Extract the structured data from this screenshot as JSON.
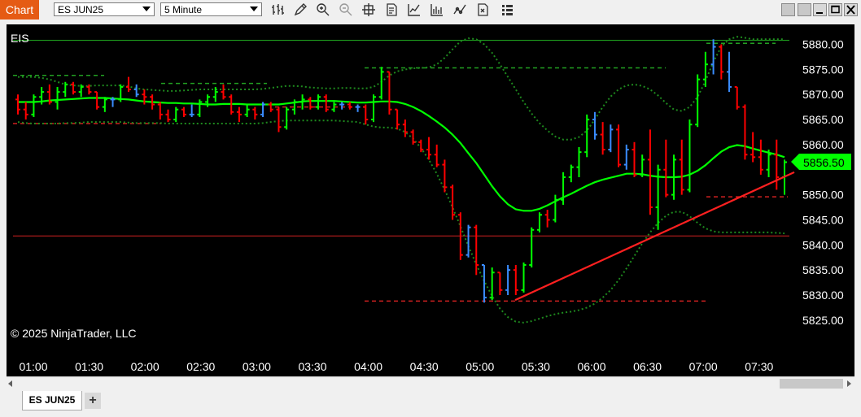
{
  "window": {
    "app_title": "Chart",
    "instrument": "ES JUN25",
    "interval": "5 Minute",
    "tab_label": "ES JUN25",
    "add_tab": "+"
  },
  "toolbar_icons": [
    "bar-type-icon",
    "draw-tool-icon",
    "zoom-in-icon",
    "zoom-out-icon",
    "crosshair-icon",
    "data-box-icon",
    "indicators-icon",
    "strategies-icon",
    "properties-icon",
    "templates-icon"
  ],
  "chart": {
    "label": "EIS",
    "copyright": "© 2025 NinjaTrader, LLC",
    "current_price": "5856.50",
    "colors": {
      "up": "#00ff00",
      "down": "#ff0000",
      "neutral": "#3a8cff",
      "ma": "#00ff00",
      "band": "#1e8a1e",
      "trendline": "#ff2020",
      "price_tag": "#00ff00"
    }
  },
  "chart_data": {
    "type": "bar",
    "instrument": "ES JUN25",
    "interval": "5 Minute",
    "ylim": [
      5821,
      5883
    ],
    "y_ticks": [
      "5880.00",
      "5875.00",
      "5870.00",
      "5865.00",
      "5860.00",
      "5855.00",
      "5850.00",
      "5845.00",
      "5840.00",
      "5835.00",
      "5830.00",
      "5825.00"
    ],
    "x_ticks": [
      "01:00",
      "01:30",
      "02:00",
      "02:30",
      "03:00",
      "03:30",
      "04:00",
      "04:30",
      "05:00",
      "05:30",
      "06:00",
      "06:30",
      "07:00",
      "07:30"
    ],
    "last_price": 5856.5,
    "ohlc": [
      [
        5869.0,
        5870.0,
        5866.0,
        5867.0
      ],
      [
        5867.0,
        5868.5,
        5865.0,
        5866.0
      ],
      [
        5866.0,
        5870.0,
        5865.5,
        5869.5
      ],
      [
        5869.5,
        5871.5,
        5868.0,
        5870.5
      ],
      [
        5870.5,
        5872.0,
        5868.0,
        5868.5
      ],
      [
        5868.5,
        5871.5,
        5867.0,
        5870.5
      ],
      [
        5870.5,
        5872.5,
        5869.5,
        5872.0
      ],
      [
        5872.0,
        5872.5,
        5870.0,
        5870.5
      ],
      [
        5870.5,
        5872.0,
        5869.5,
        5871.5
      ],
      [
        5871.5,
        5872.0,
        5870.0,
        5870.5
      ],
      [
        5870.5,
        5870.5,
        5867.0,
        5867.5
      ],
      [
        5867.5,
        5869.5,
        5866.5,
        5869.0
      ],
      [
        5869.0,
        5869.5,
        5867.5,
        5869.0
      ],
      [
        5869.0,
        5872.0,
        5868.5,
        5871.5
      ],
      [
        5871.5,
        5873.5,
        5870.5,
        5871.0
      ],
      [
        5871.0,
        5872.0,
        5869.5,
        5870.0
      ],
      [
        5870.0,
        5871.0,
        5868.0,
        5869.5
      ],
      [
        5869.5,
        5870.0,
        5867.0,
        5868.0
      ],
      [
        5868.0,
        5868.5,
        5865.0,
        5866.0
      ],
      [
        5866.0,
        5867.0,
        5864.5,
        5865.0
      ],
      [
        5865.0,
        5867.5,
        5864.5,
        5867.0
      ],
      [
        5867.0,
        5867.5,
        5865.5,
        5866.0
      ],
      [
        5866.0,
        5868.0,
        5865.5,
        5866.0
      ],
      [
        5866.0,
        5869.0,
        5865.5,
        5868.5
      ],
      [
        5868.5,
        5870.0,
        5867.5,
        5869.5
      ],
      [
        5869.5,
        5871.5,
        5868.5,
        5870.5
      ],
      [
        5870.5,
        5872.0,
        5869.0,
        5869.5
      ],
      [
        5869.5,
        5870.0,
        5866.0,
        5866.5
      ],
      [
        5866.5,
        5867.5,
        5864.5,
        5866.0
      ],
      [
        5866.0,
        5868.0,
        5865.5,
        5867.0
      ],
      [
        5867.0,
        5867.5,
        5865.0,
        5866.0
      ],
      [
        5866.0,
        5868.5,
        5865.5,
        5868.0
      ],
      [
        5868.0,
        5868.5,
        5866.5,
        5867.0
      ],
      [
        5867.0,
        5867.5,
        5862.5,
        5863.5
      ],
      [
        5863.5,
        5867.5,
        5863.0,
        5867.0
      ],
      [
        5867.0,
        5869.0,
        5866.0,
        5868.5
      ],
      [
        5868.5,
        5870.0,
        5867.0,
        5869.0
      ],
      [
        5869.0,
        5869.5,
        5867.0,
        5867.5
      ],
      [
        5867.5,
        5870.0,
        5867.0,
        5869.5
      ],
      [
        5869.5,
        5870.0,
        5866.5,
        5867.0
      ],
      [
        5867.0,
        5868.5,
        5866.5,
        5868.0
      ],
      [
        5868.0,
        5868.5,
        5867.0,
        5868.0
      ],
      [
        5868.0,
        5868.5,
        5867.0,
        5867.5
      ],
      [
        5867.5,
        5868.0,
        5866.5,
        5867.5
      ],
      [
        5867.5,
        5868.0,
        5864.0,
        5865.0
      ],
      [
        5865.0,
        5870.0,
        5864.5,
        5869.5
      ],
      [
        5869.5,
        5875.5,
        5869.0,
        5874.5
      ],
      [
        5874.5,
        5874.5,
        5866.0,
        5867.0
      ],
      [
        5867.0,
        5867.0,
        5863.0,
        5864.0
      ],
      [
        5864.0,
        5865.0,
        5861.5,
        5862.5
      ],
      [
        5862.5,
        5863.0,
        5860.0,
        5860.5
      ],
      [
        5860.5,
        5861.0,
        5858.5,
        5859.0
      ],
      [
        5859.0,
        5861.5,
        5857.0,
        5858.0
      ],
      [
        5858.0,
        5860.0,
        5855.5,
        5856.0
      ],
      [
        5856.0,
        5857.0,
        5850.5,
        5851.5
      ],
      [
        5851.5,
        5852.0,
        5845.0,
        5846.0
      ],
      [
        5846.0,
        5846.5,
        5837.0,
        5838.0
      ],
      [
        5838.0,
        5844.0,
        5837.5,
        5843.5
      ],
      [
        5843.5,
        5844.0,
        5834.0,
        5836.0
      ],
      [
        5836.0,
        5836.0,
        5828.5,
        5829.5
      ],
      [
        5829.5,
        5835.5,
        5829.0,
        5834.5
      ],
      [
        5834.5,
        5834.5,
        5830.0,
        5831.0
      ],
      [
        5831.0,
        5836.0,
        5830.0,
        5835.0
      ],
      [
        5835.0,
        5836.0,
        5830.0,
        5831.0
      ],
      [
        5831.0,
        5836.5,
        5830.5,
        5836.0
      ],
      [
        5836.0,
        5843.5,
        5835.5,
        5843.0
      ],
      [
        5843.0,
        5846.5,
        5842.5,
        5846.0
      ],
      [
        5846.0,
        5847.0,
        5843.5,
        5845.0
      ],
      [
        5845.0,
        5850.0,
        5844.5,
        5849.0
      ],
      [
        5849.0,
        5854.5,
        5848.0,
        5853.5
      ],
      [
        5853.5,
        5856.0,
        5852.5,
        5855.5
      ],
      [
        5855.5,
        5859.5,
        5853.5,
        5858.5
      ],
      [
        5858.5,
        5866.0,
        5857.5,
        5865.0
      ],
      [
        5865.0,
        5866.5,
        5861.0,
        5862.0
      ],
      [
        5862.0,
        5864.5,
        5858.0,
        5859.0
      ],
      [
        5859.0,
        5864.0,
        5858.5,
        5863.0
      ],
      [
        5863.0,
        5864.0,
        5855.5,
        5856.0
      ],
      [
        5856.0,
        5860.0,
        5855.0,
        5859.0
      ],
      [
        5859.0,
        5860.5,
        5853.5,
        5854.0
      ],
      [
        5854.0,
        5858.0,
        5853.5,
        5857.0
      ],
      [
        5857.0,
        5863.0,
        5846.0,
        5847.5
      ],
      [
        5847.5,
        5856.0,
        5843.0,
        5855.0
      ],
      [
        5855.0,
        5861.0,
        5849.5,
        5850.0
      ],
      [
        5850.0,
        5858.0,
        5849.0,
        5857.0
      ],
      [
        5857.0,
        5861.0,
        5850.0,
        5851.0
      ],
      [
        5851.0,
        5865.0,
        5850.5,
        5864.0
      ],
      [
        5864.0,
        5874.0,
        5863.5,
        5873.0
      ],
      [
        5873.0,
        5878.5,
        5871.5,
        5876.0
      ],
      [
        5876.0,
        5881.0,
        5874.0,
        5879.5
      ],
      [
        5879.5,
        5880.0,
        5873.0,
        5874.5
      ],
      [
        5874.5,
        5878.5,
        5870.5,
        5871.5
      ],
      [
        5871.5,
        5871.5,
        5867.0,
        5867.5
      ],
      [
        5867.5,
        5868.0,
        5857.0,
        5858.0
      ],
      [
        5858.0,
        5862.5,
        5856.5,
        5857.5
      ],
      [
        5857.5,
        5861.0,
        5854.0,
        5855.0
      ],
      [
        5855.0,
        5859.0,
        5853.5,
        5858.0
      ],
      [
        5858.0,
        5861.0,
        5851.0,
        5853.5
      ],
      [
        5853.5,
        5857.0,
        5850.0,
        5856.5
      ]
    ],
    "moving_average": [
      5868.5,
      5868.5,
      5868.5,
      5868.6,
      5868.8,
      5868.9,
      5869.0,
      5869.1,
      5869.2,
      5869.3,
      5869.3,
      5869.3,
      5869.2,
      5869.1,
      5869.0,
      5868.8,
      5868.6,
      5868.5,
      5868.4,
      5868.3,
      5868.3,
      5868.2,
      5868.2,
      5868.1,
      5868.0,
      5868.0,
      5868.1,
      5868.1,
      5868.1,
      5868.0,
      5868.0,
      5868.0,
      5868.0,
      5868.0,
      5868.2,
      5868.4,
      5868.6,
      5868.7,
      5868.7,
      5868.7,
      5868.7,
      5868.6,
      5868.5,
      5868.4,
      5868.4,
      5868.5,
      5868.6,
      5868.6,
      5868.5,
      5868.1,
      5867.5,
      5866.7,
      5865.7,
      5864.6,
      5863.4,
      5862.0,
      5860.3,
      5858.3,
      5856.3,
      5854.0,
      5851.7,
      5849.7,
      5848.1,
      5847.1,
      5846.8,
      5846.8,
      5847.2,
      5847.9,
      5848.7,
      5849.5,
      5850.2,
      5851.0,
      5851.8,
      5852.5,
      5853.0,
      5853.4,
      5853.8,
      5854.2,
      5854.2,
      5854.1,
      5853.8,
      5853.6,
      5853.5,
      5853.5,
      5853.6,
      5854.0,
      5854.8,
      5855.9,
      5857.3,
      5858.6,
      5859.5,
      5859.9,
      5859.7,
      5859.2,
      5858.8,
      5858.4,
      5858.0,
      5857.5
    ],
    "band_upper": [
      5873.5,
      5873.5,
      5873.5,
      5873.3,
      5873.0,
      5872.5,
      5872.0,
      5871.8,
      5871.7,
      5871.7,
      5871.8,
      5871.8,
      5871.8,
      5871.8,
      5871.6,
      5871.2,
      5871.0,
      5870.9,
      5870.8,
      5870.7,
      5870.7,
      5870.8,
      5870.9,
      5871.0,
      5871.0,
      5871.0,
      5871.0,
      5871.0,
      5871.0,
      5871.0,
      5871.0,
      5871.1,
      5871.3,
      5871.5,
      5871.7,
      5871.7,
      5871.6,
      5871.4,
      5871.3,
      5871.2,
      5871.2,
      5871.3,
      5871.3,
      5871.2,
      5871.2,
      5871.5,
      5872.5,
      5873.8,
      5874.6,
      5875.0,
      5875.2,
      5875.3,
      5875.4,
      5876.0,
      5877.3,
      5879.0,
      5880.6,
      5881.2,
      5881.0,
      5880.0,
      5878.3,
      5876.0,
      5873.5,
      5871.0,
      5868.5,
      5866.2,
      5864.3,
      5862.8,
      5861.6,
      5861.0,
      5861.0,
      5861.5,
      5862.8,
      5865.0,
      5867.5,
      5869.6,
      5871.0,
      5871.8,
      5872.0,
      5871.7,
      5871.0,
      5869.8,
      5868.3,
      5867.0,
      5866.7,
      5867.5,
      5869.5,
      5872.7,
      5876.5,
      5879.5,
      5881.0,
      5881.5,
      5881.3,
      5881.0,
      5881.0,
      5881.0,
      5881.0,
      5881.0
    ],
    "band_lower": [
      5864.5,
      5864.3,
      5864.2,
      5864.2,
      5864.2,
      5864.2,
      5864.3,
      5864.3,
      5864.4,
      5864.5,
      5864.5,
      5864.5,
      5864.5,
      5864.5,
      5864.4,
      5864.3,
      5864.3,
      5864.3,
      5864.3,
      5864.2,
      5864.2,
      5864.2,
      5864.2,
      5864.2,
      5864.2,
      5864.2,
      5864.2,
      5864.2,
      5864.2,
      5864.2,
      5864.2,
      5864.3,
      5864.5,
      5864.7,
      5864.8,
      5864.8,
      5864.8,
      5864.8,
      5864.8,
      5864.8,
      5864.8,
      5864.7,
      5864.6,
      5864.5,
      5864.0,
      5863.6,
      5863.4,
      5863.4,
      5863.2,
      5862.5,
      5861.2,
      5859.3,
      5857.0,
      5854.2,
      5851.0,
      5847.5,
      5843.7,
      5839.8,
      5836.1,
      5832.8,
      5829.8,
      5827.3,
      5825.6,
      5824.7,
      5824.5,
      5824.8,
      5825.3,
      5825.8,
      5826.2,
      5826.5,
      5826.7,
      5827.0,
      5827.5,
      5828.3,
      5829.5,
      5831.0,
      5833.0,
      5835.3,
      5837.8,
      5840.3,
      5842.5,
      5844.4,
      5845.8,
      5846.6,
      5846.6,
      5845.7,
      5844.4,
      5843.3,
      5842.7,
      5842.5,
      5842.5,
      5842.5,
      5842.5,
      5842.5,
      5842.5,
      5842.5,
      5842.4,
      5842.3
    ]
  }
}
